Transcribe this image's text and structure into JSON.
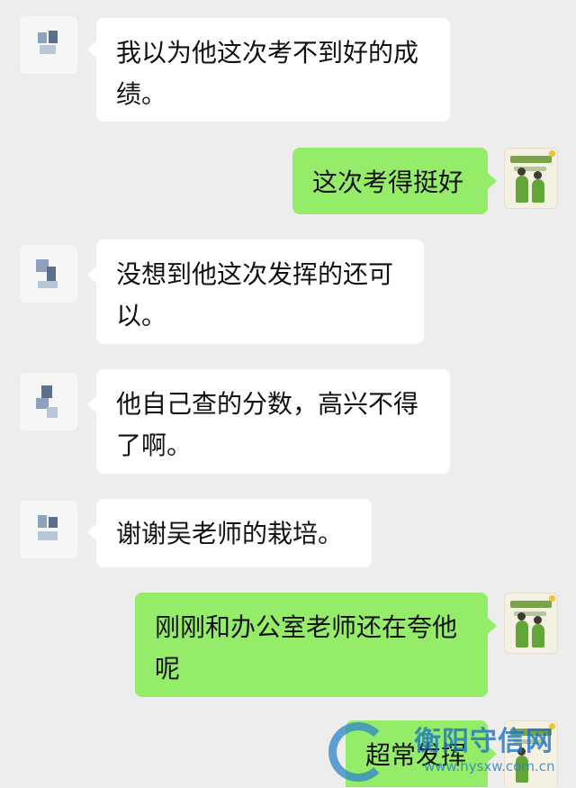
{
  "chat": {
    "messages": [
      {
        "id": "msg-1",
        "side": "in",
        "text": "我以为他这次考不到好的成绩。"
      },
      {
        "id": "msg-2",
        "side": "out",
        "text": "这次考得挺好"
      },
      {
        "id": "msg-3",
        "side": "in",
        "text": "没想到他这次发挥的还可以。"
      },
      {
        "id": "msg-4",
        "side": "in",
        "text": "他自己查的分数，高兴不得了啊。"
      },
      {
        "id": "msg-5",
        "side": "in",
        "text": "谢谢吴老师的栽培。"
      },
      {
        "id": "msg-6",
        "side": "out",
        "text": "刚刚和办公室老师还在夸他呢"
      },
      {
        "id": "msg-7",
        "side": "out",
        "text": "超常发挥"
      }
    ]
  },
  "watermark": {
    "title": "衡阳守信网",
    "url": "www.hysxw.com.cn"
  },
  "colors": {
    "background": "#ededed",
    "incoming_bubble": "#ffffff",
    "outgoing_bubble": "#95ec69"
  }
}
